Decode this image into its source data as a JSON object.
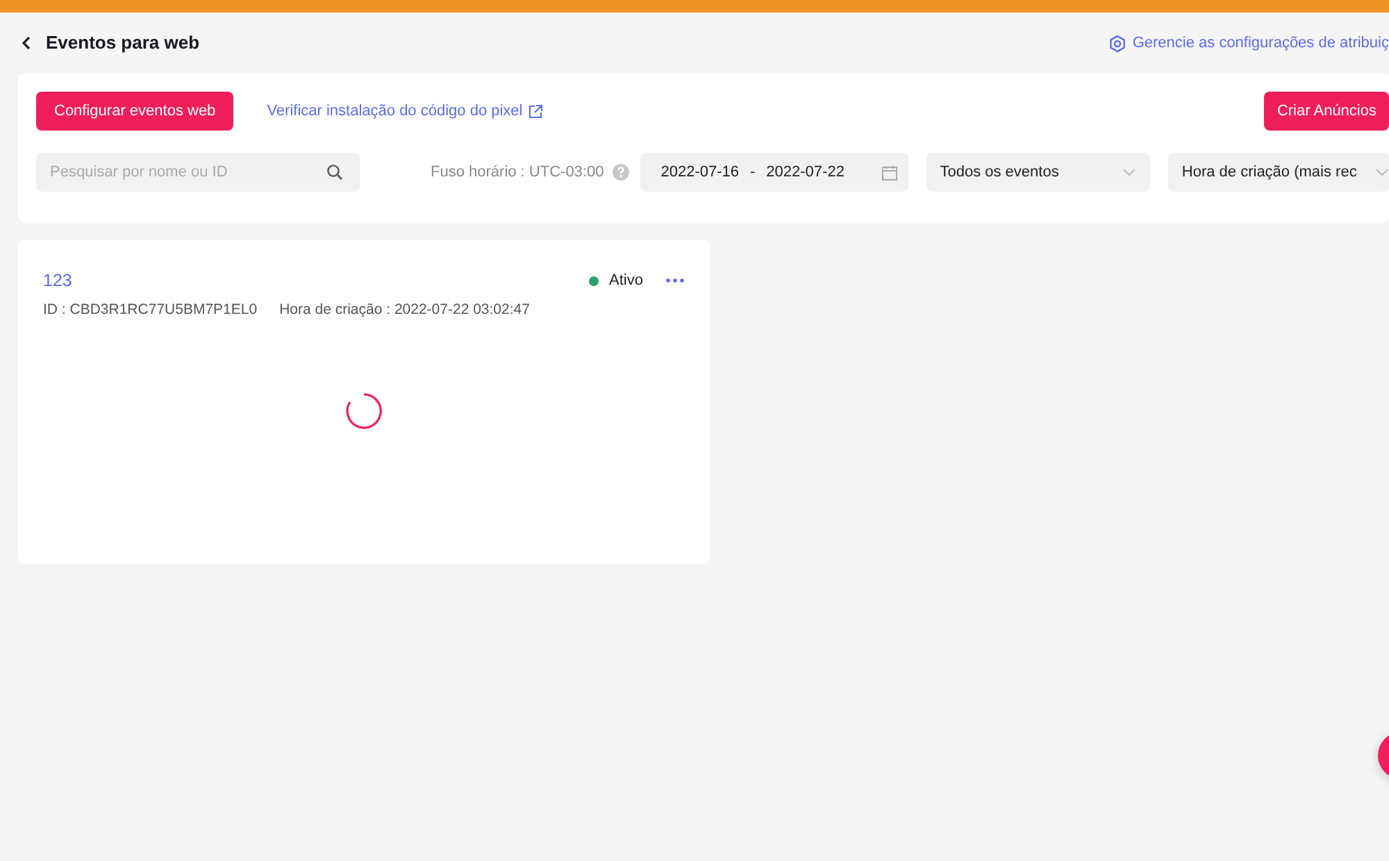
{
  "banner": {
    "color": "#ef9424"
  },
  "header": {
    "title": "Eventos para web",
    "settings_link": "Gerencie as configurações de atribuiç"
  },
  "toolbar": {
    "primary_button": "Configurar eventos web",
    "verify_link": "Verificar instalação do código do pixel",
    "create_button": "Criar Anúncios"
  },
  "filters": {
    "search": {
      "placeholder": "Pesquisar por nome ou ID"
    },
    "timezone": "Fuso horário : UTC-03:00",
    "date_start": "2022-07-16",
    "date_separator": "-",
    "date_end": "2022-07-22",
    "event_filter": "Todos os eventos",
    "sort": "Hora de criação (mais rec"
  },
  "pixels": [
    {
      "name": "123",
      "id": "ID : CBD3R1RC77U5BM7P1EL0",
      "created": "Hora de criação : 2022-07-22 03:02:47",
      "status": "Ativo",
      "color": "#27a26b",
      "loading": true
    }
  ]
}
